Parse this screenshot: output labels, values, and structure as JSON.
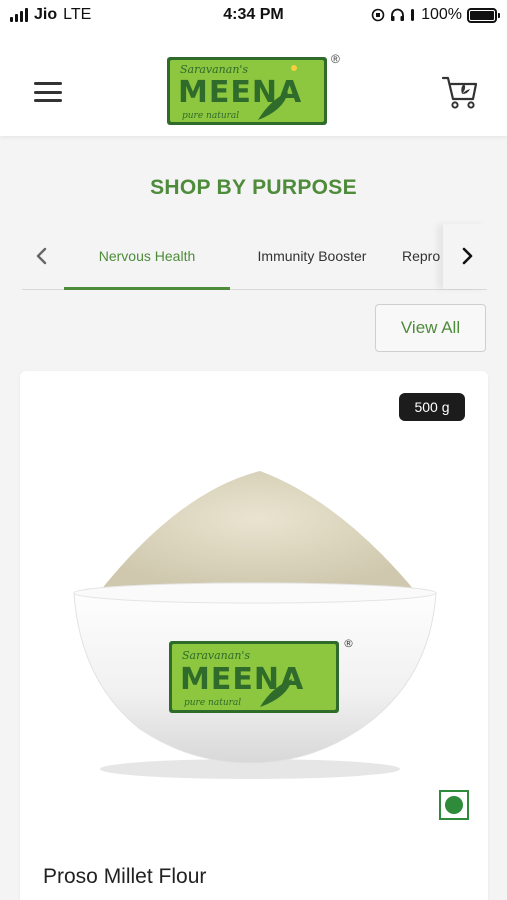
{
  "status_bar": {
    "carrier": "Jio",
    "network": "LTE",
    "time": "4:34 PM",
    "battery": "100%",
    "battery_level": 1.0
  },
  "header": {
    "logo": {
      "script": "Saravanan's",
      "brand": "MEENA",
      "tagline": "pure natural",
      "registered": "®"
    },
    "icons": [
      "menu-icon",
      "cart-icon"
    ]
  },
  "section_title": "SHOP BY PURPOSE",
  "tabs": {
    "items": [
      {
        "label": "Nervous Health",
        "active": true
      },
      {
        "label": "Immunity Booster",
        "active": false
      },
      {
        "label": "Repro",
        "active": false
      }
    ],
    "icons": [
      "chevron-left-icon",
      "chevron-right-icon"
    ]
  },
  "view_all_label": "View All",
  "product": {
    "weight": "500 g",
    "name": "Proso Millet Flour",
    "veg_indicator": "veg-mark-icon"
  },
  "colors": {
    "accent": "#4e8b3a",
    "logo_green": "#8dc63f",
    "logo_dark": "#2f6b2a",
    "badge_bg": "#1c1c1c",
    "veg_green": "#2e8b3a"
  }
}
